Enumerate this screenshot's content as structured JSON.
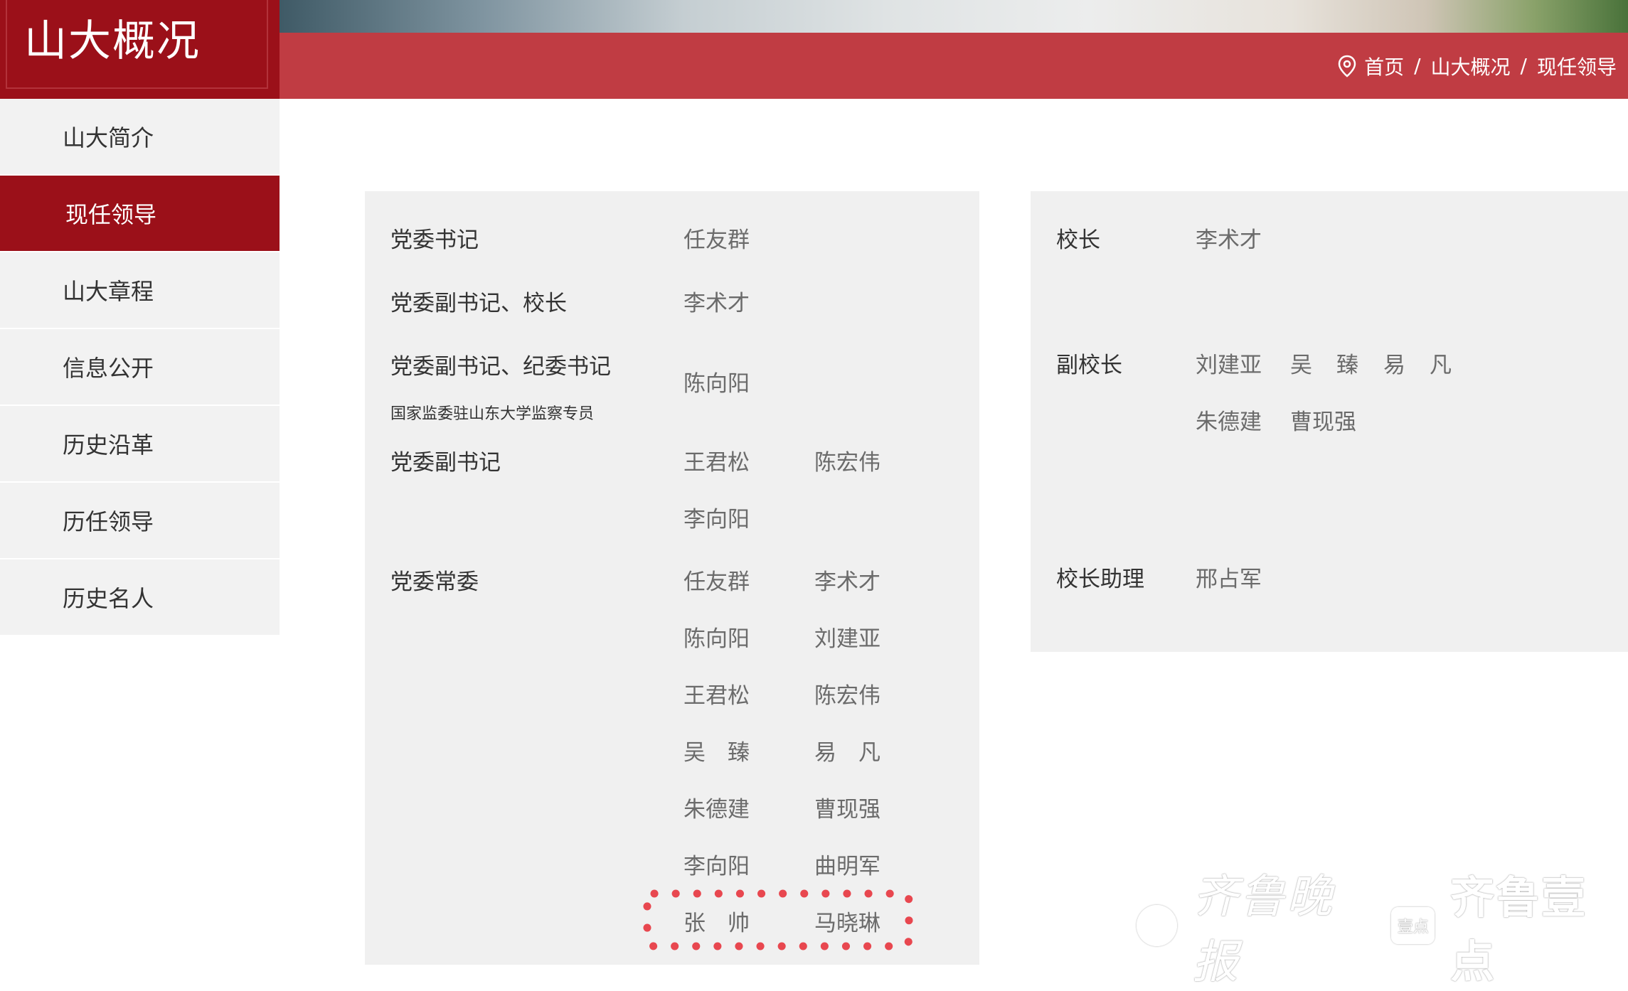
{
  "section_title": "山大概况",
  "breadcrumb": {
    "home": "首页",
    "section": "山大概况",
    "current": "现任领导",
    "separator": "/",
    "icon": "location-pin-icon"
  },
  "sidebar": {
    "items": [
      {
        "label": "山大简介",
        "active": false
      },
      {
        "label": "现任领导",
        "active": true
      },
      {
        "label": "山大章程",
        "active": false
      },
      {
        "label": "信息公开",
        "active": false
      },
      {
        "label": "历史沿革",
        "active": false
      },
      {
        "label": "历任领导",
        "active": false
      },
      {
        "label": "历史名人",
        "active": false
      }
    ]
  },
  "party": {
    "secretary": {
      "role": "党委书记",
      "names": [
        "任友群"
      ]
    },
    "deputy_president": {
      "role": "党委副书记、校长",
      "names": [
        "李术才"
      ]
    },
    "deputy_discipline": {
      "role": "党委副书记、纪委书记",
      "sub": "国家监委驻山东大学监察专员",
      "names": [
        "陈向阳"
      ]
    },
    "deputy": {
      "role": "党委副书记",
      "names": [
        "王君松",
        "陈宏伟",
        "李向阳"
      ]
    },
    "standing": {
      "role": "党委常委",
      "names": [
        "任友群",
        "李术才",
        "陈向阳",
        "刘建亚",
        "王君松",
        "陈宏伟",
        "吴　臻",
        "易　凡",
        "朱德建",
        "曹现强",
        "李向阳",
        "曲明军",
        "张　帅",
        "马晓琳"
      ]
    }
  },
  "admin": {
    "president": {
      "role": "校长",
      "names": [
        "李术才"
      ]
    },
    "vice": {
      "role": "副校长",
      "names": [
        "刘建亚",
        "吴",
        "臻",
        "易",
        "凡",
        "朱德建",
        "曹现强"
      ]
    },
    "assistant": {
      "role": "校长助理",
      "names": [
        "邢占军"
      ]
    }
  },
  "colors": {
    "brand_dark": "#9b1019",
    "brand": "#c03c43",
    "panel": "#f0f0f0",
    "highlight": "#e8474f"
  },
  "watermark": {
    "brand1": "齐鲁晚报",
    "box": "壹点",
    "brand2": "齐鲁壹点"
  }
}
